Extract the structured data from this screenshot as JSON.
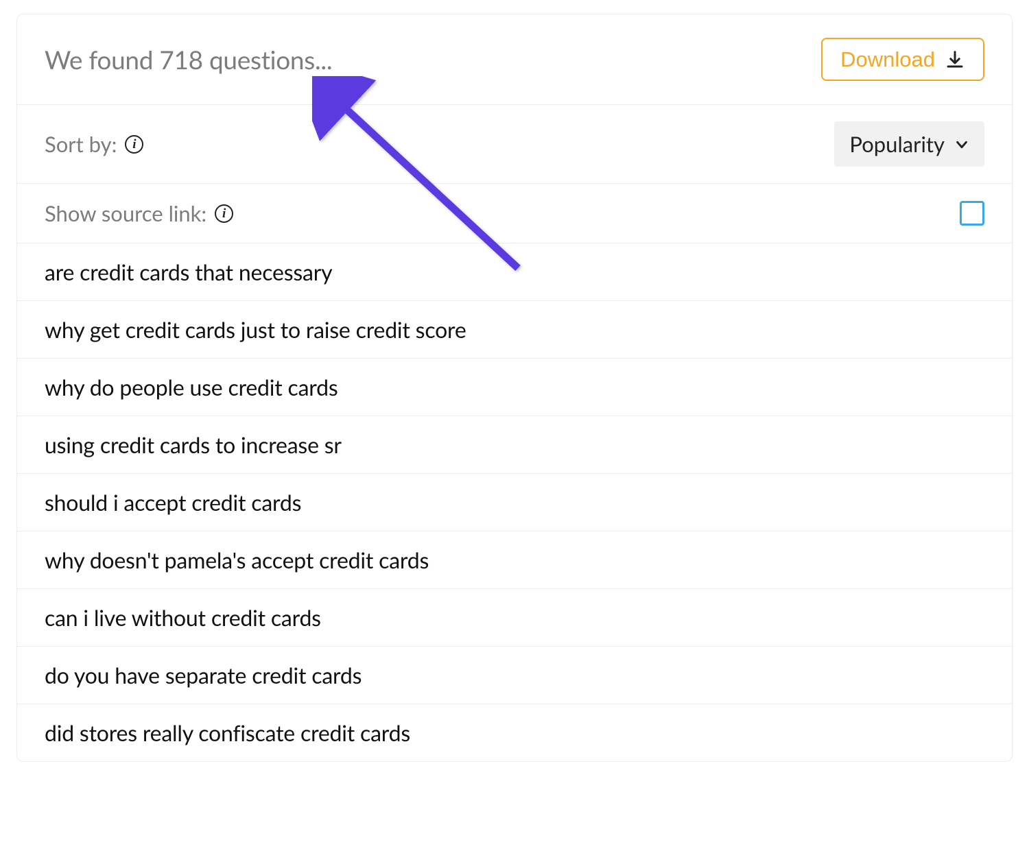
{
  "header": {
    "results_title": "We found 718 questions...",
    "download_label": "Download"
  },
  "sort": {
    "label_prefix": "Sort by:",
    "selected": "Popularity"
  },
  "show_source": {
    "label_prefix": "Show source link:",
    "checked": false
  },
  "questions": [
    "are credit cards that necessary",
    "why get credit cards just to raise credit score",
    "why do people use credit cards",
    "using credit cards to increase sr",
    "should i accept credit cards",
    "why doesn't pamela's accept credit cards",
    "can i live without credit cards",
    "do you have separate credit cards",
    "did stores really confiscate credit cards"
  ],
  "colors": {
    "accent_orange": "#f5a623",
    "checkbox_blue": "#3aa7e6",
    "arrow_purple": "#5b3be0"
  }
}
